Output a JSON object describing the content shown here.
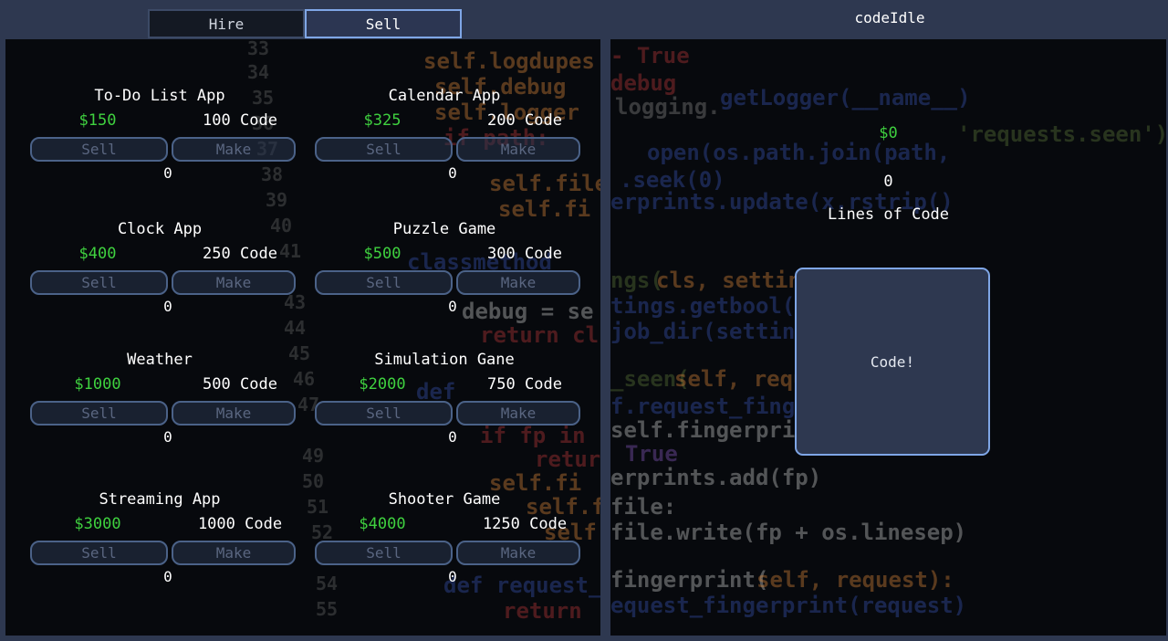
{
  "tabs": {
    "hire": "Hire",
    "sell": "Sell"
  },
  "app_title": "codeIdle",
  "buttons": {
    "sell": "Sell",
    "make": "Make"
  },
  "products": [
    {
      "name": "To-Do List App",
      "price": "$150",
      "cost": "100 Code",
      "count": "0"
    },
    {
      "name": "Calendar App",
      "price": "$325",
      "cost": "200 Code",
      "count": "0"
    },
    {
      "name": "Clock App",
      "price": "$400",
      "cost": "250 Code",
      "count": "0"
    },
    {
      "name": "Puzzle Game",
      "price": "$500",
      "cost": "300 Code",
      "count": "0"
    },
    {
      "name": "Weather",
      "price": "$1000",
      "cost": "500 Code",
      "count": "0"
    },
    {
      "name": "Simulation Gane",
      "price": "$2000",
      "cost": "750 Code",
      "count": "0"
    },
    {
      "name": "Streaming App",
      "price": "$3000",
      "cost": "1000 Code",
      "count": "0"
    },
    {
      "name": "Shooter Game",
      "price": "$4000",
      "cost": "1250 Code",
      "count": "0"
    }
  ],
  "stats": {
    "money": "$0",
    "lines_count": "0",
    "lines_label": "Lines of Code"
  },
  "code_button": "Code!",
  "colors": {
    "money_green": "#3fd13f",
    "accent_blue": "#7fa6e6",
    "panel_bg": "#07090d",
    "chrome_bg": "#2e3850"
  }
}
